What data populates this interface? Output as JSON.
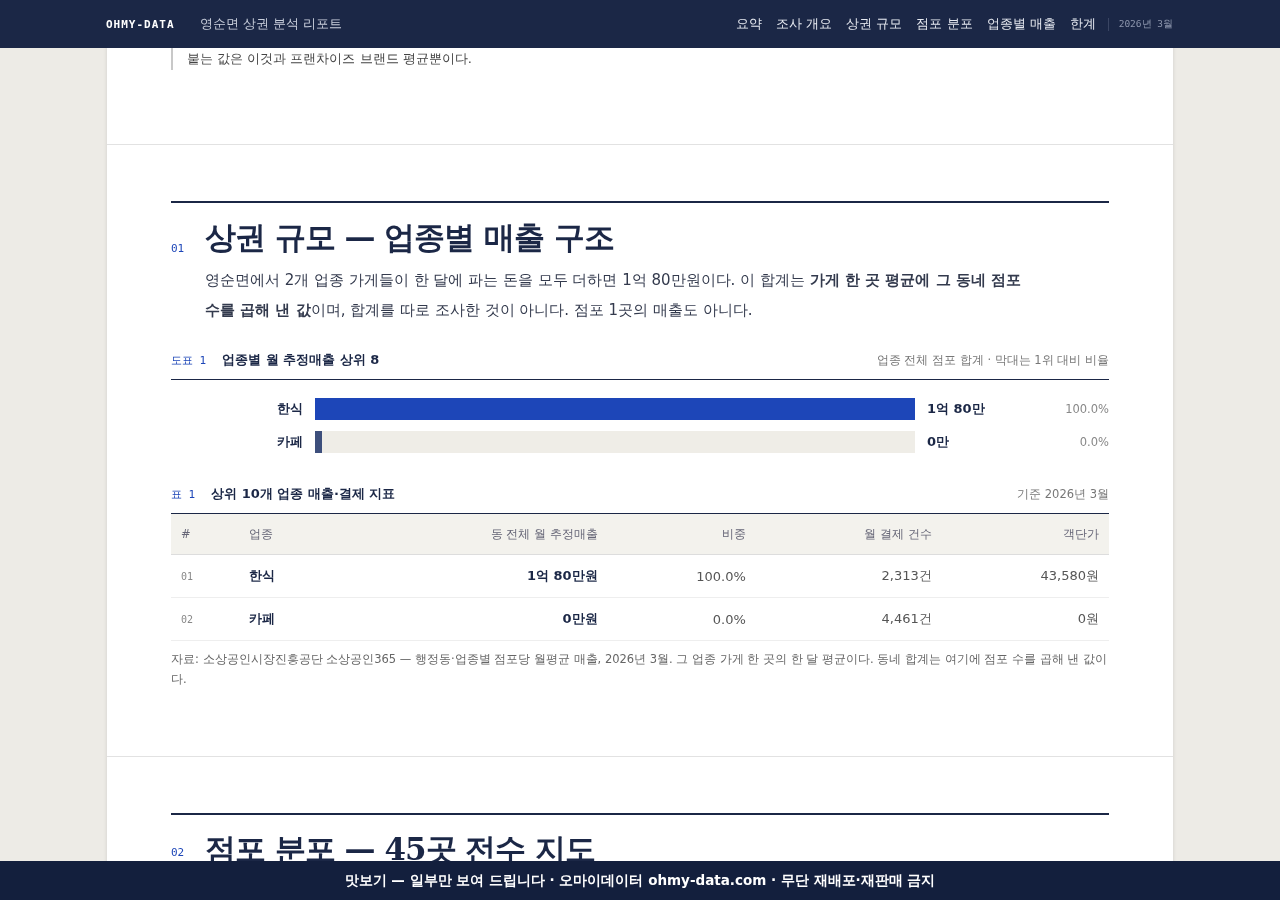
{
  "header": {
    "logo": "OHMY-DATA",
    "title": "영순면 상권 분석 리포트",
    "nav": [
      {
        "label": "요약",
        "selected": false
      },
      {
        "label": "조사 개요",
        "selected": false
      },
      {
        "label": "상권 규모",
        "selected": false
      },
      {
        "label": "점포 분포",
        "selected": false
      },
      {
        "label": "업종별 매출",
        "selected": false
      },
      {
        "label": "한계",
        "selected": false
      }
    ],
    "date": "2026년 3월"
  },
  "quote": "붙는 값은 이것과 프랜차이즈 브랜드 평균뿐이다.",
  "section": {
    "number": "01",
    "title": "상권 규모 — 업종별 매출 구조",
    "lead": "영순면에서 2개 업종 가게들이 한 달에 파는 돈을 모두 더하면 1억 80만원이다. 이 합계는 **가게 한 곳 평균에 그 동네 점포 수를 곱해 낸 값**이며, 합계를 따로 조사한 것이 아니다. 점포 1곳의 매출도 아니다.",
    "figure": {
      "tag": "도표 1",
      "title": "업종별 월 추정매출 상위 8",
      "note": "업종 전체 점포 합계 · 막대는 1위 대비 비율",
      "bars": [
        {
          "label": "한식",
          "value": "1억 80만",
          "share": "100.0%",
          "level": 1,
          "highlighted": true
        },
        {
          "label": "카페",
          "value": "0만",
          "share": "0.0%",
          "level": 0,
          "highlighted": false
        }
      ]
    },
    "table": {
      "tag": "표 1",
      "title": "상위 10개 업종 매출·결제 지표",
      "note": "기준 2026년 3월",
      "columns": [
        "#",
        "업종",
        "동 전체 월 추정매출",
        "비중",
        "월 결제 건수",
        "객단가"
      ],
      "rows": [
        [
          "01",
          "한식",
          "1억 80만원",
          "100.0%",
          "2,313건",
          "43,580원"
        ],
        [
          "02",
          "카페",
          "0만원",
          "0.0%",
          "4,461건",
          "0원"
        ]
      ],
      "source": "자료: 소상공인시장진흥공단 소상공인365 — 행정동·업종별 점포당 월평균 매출, 2026년 3월. 그 업종 가게 한 곳의 한 달 평균이다. 동네 합계는 여기에 점포 수를 곱해 낸 값이다."
    }
  },
  "next_section": {
    "number": "02",
    "title": "점포 분포 — 45곳 전수 지도"
  },
  "footer": "맛보기 — 일부만 보여 드립니다 · 오마이데이터 ohmy-data.com · 무단 재배포·재판매 금지"
}
